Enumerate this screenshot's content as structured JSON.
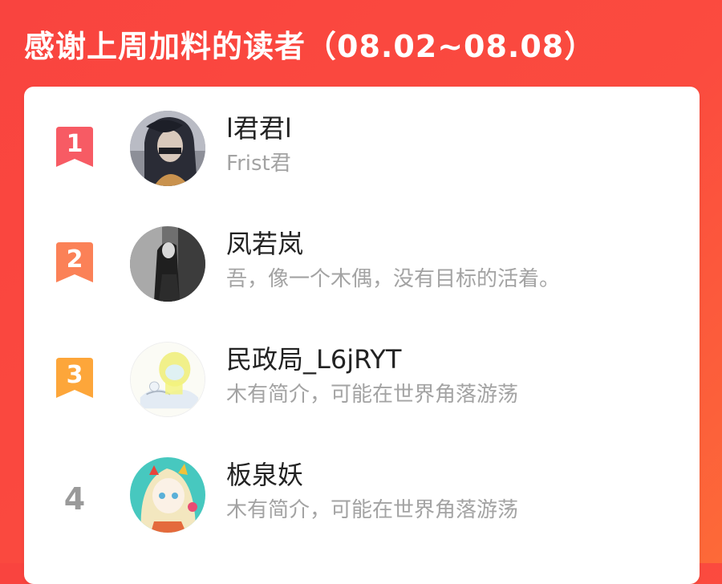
{
  "header": {
    "title": "感谢上周加料的读者（08.02~08.08）"
  },
  "colors": {
    "background_top": "#f9443f",
    "background_bottom": "#fd6a38",
    "rank1": "#f75b64",
    "rank2": "#fb8157",
    "rank3": "#fda63a",
    "rank_plain": "#9a9a9a"
  },
  "readers": [
    {
      "rank": "1",
      "name": "l君君l",
      "bio": "Frist君",
      "avatar_icon": "avatar-dark-hair-icon"
    },
    {
      "rank": "2",
      "name": "凤若岚",
      "bio": "吾，像一个木偶，没有目标的活着。",
      "avatar_icon": "avatar-monochrome-figure-icon"
    },
    {
      "rank": "3",
      "name": "民政局_L6jRYT",
      "bio": "木有简介，可能在世界角落游荡",
      "avatar_icon": "avatar-yellow-sketch-icon"
    },
    {
      "rank": "4",
      "name": "板泉妖",
      "bio": "木有简介，可能在世界角落游荡",
      "avatar_icon": "avatar-colorful-girl-icon"
    }
  ]
}
